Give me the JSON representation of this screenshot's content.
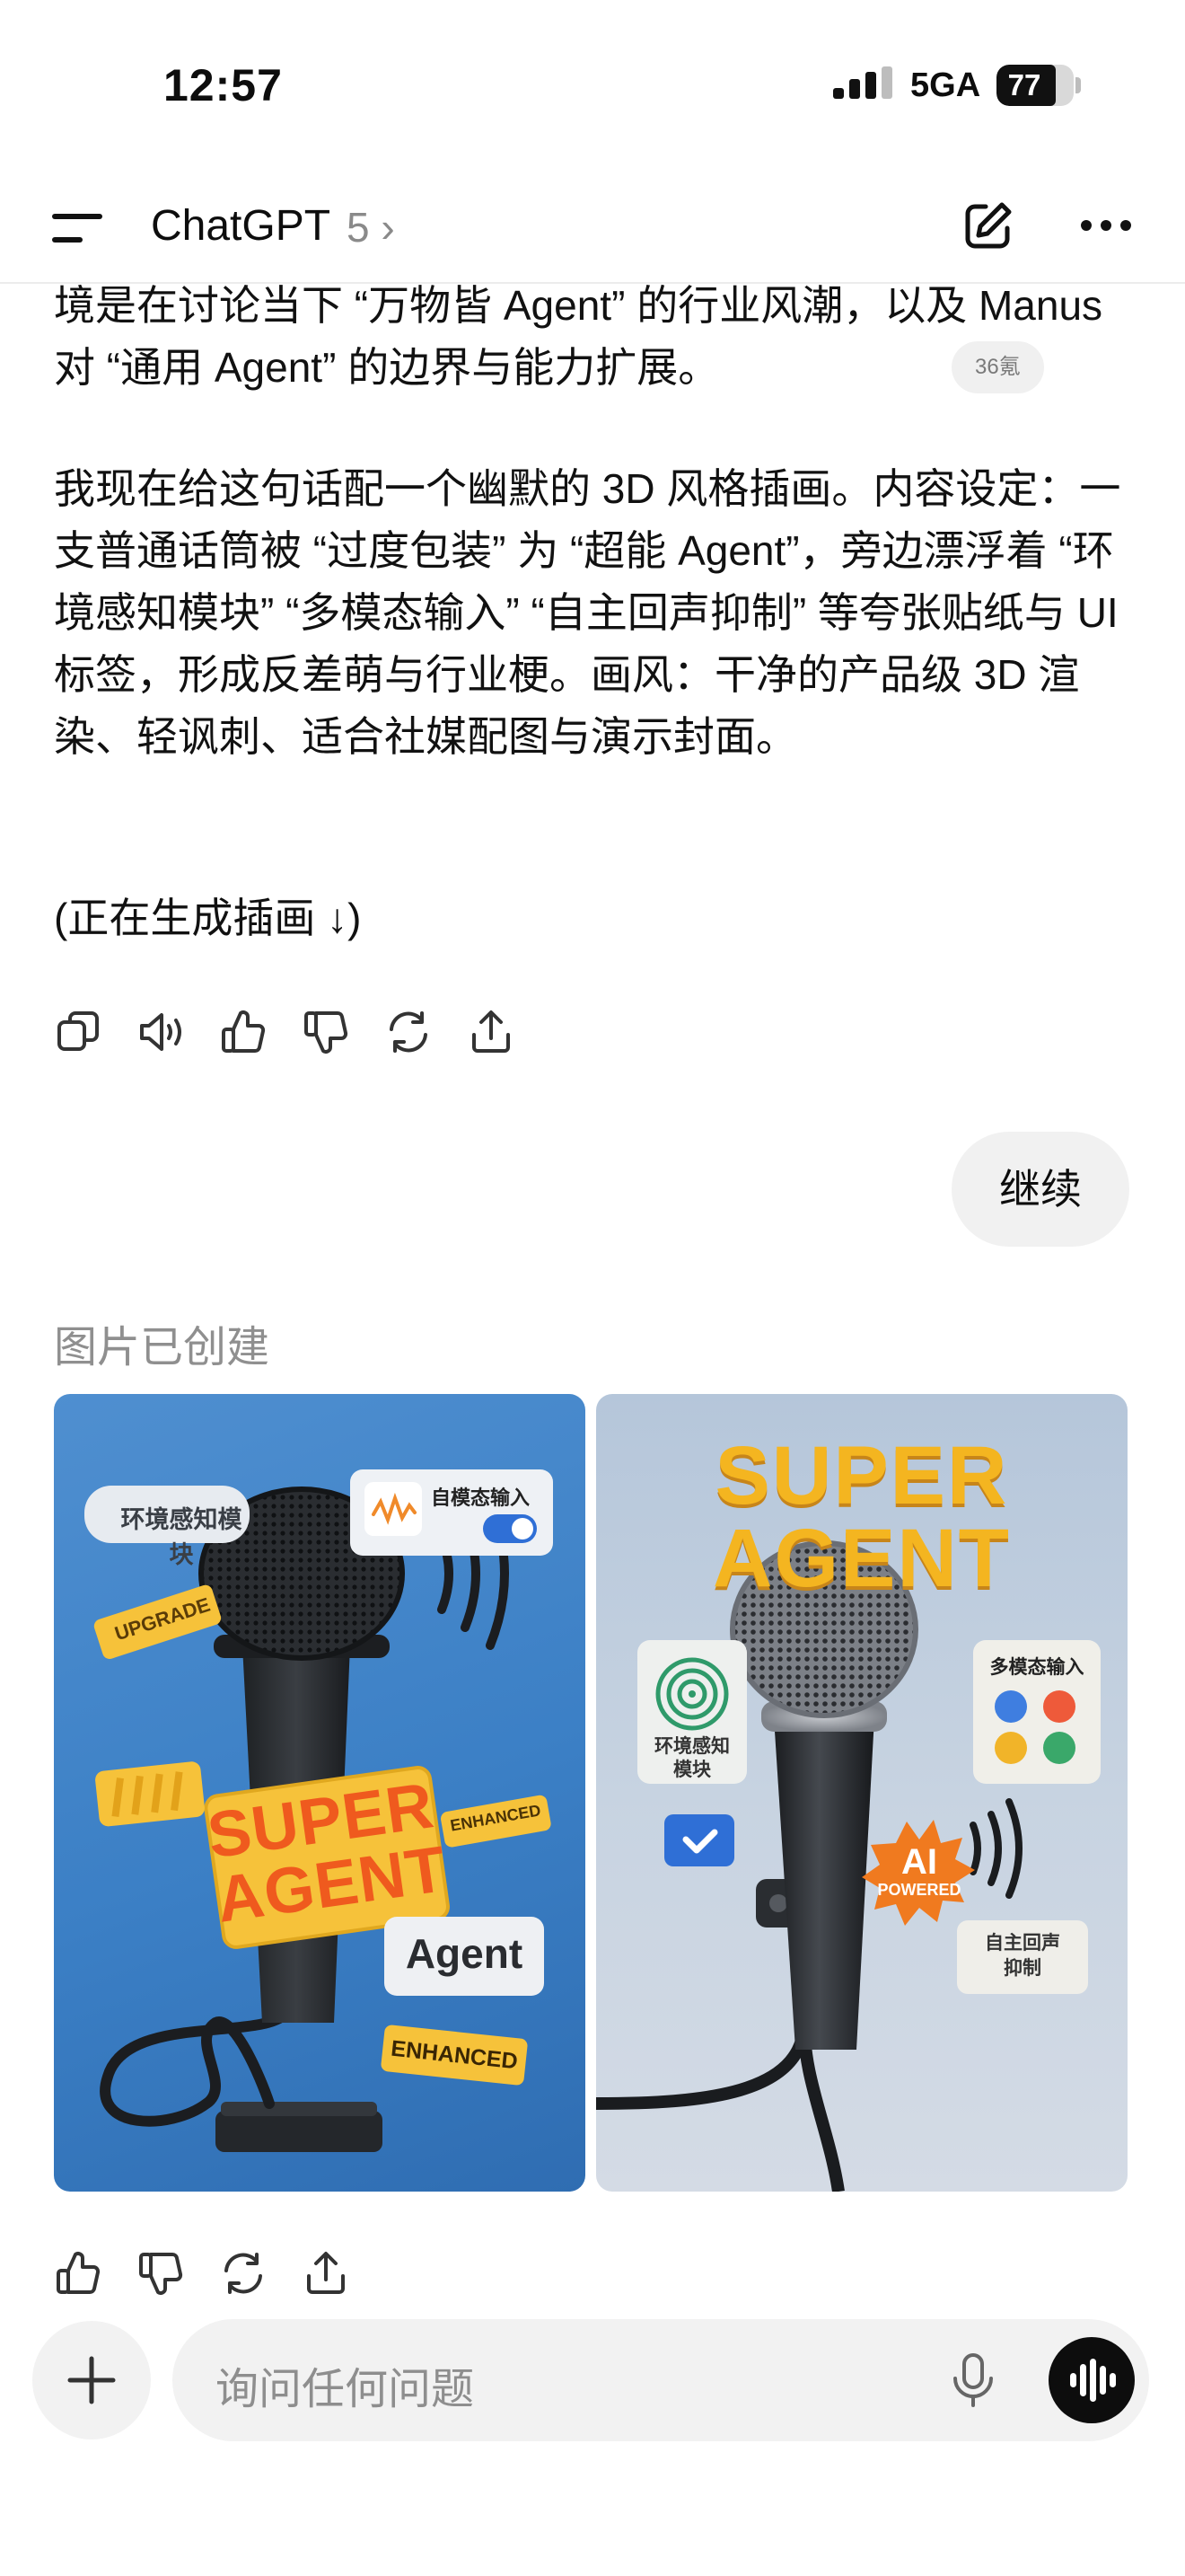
{
  "status_bar": {
    "time": "12:57",
    "network": "5GA",
    "battery": "77",
    "battery_level": 0.77
  },
  "header": {
    "title": "ChatGPT",
    "model": "5 ›"
  },
  "message": {
    "para1": "境是在讨论当下 “万物皆 Agent” 的行业风潮，以及 Manus 对 “通用 Agent” 的边界与能力扩展。",
    "citation": "36氪",
    "para2": "我现在给这句话配一个幽默的 3D 风格插画。内容设定：一支普通话筒被 “过度包装” 为 “超能 Agent”，旁边漂浮着 “环境感知模块” “多模态输入” “自主回声抑制” 等夸张贴纸与 UI 标签，形成反差萌与行业梗。画风：干净的产品级 3D 渲染、轻讽刺、适合社媒配图与演示封面。",
    "para3": "(正在生成插画 ↓)"
  },
  "user_message": "继续",
  "image_section_label": "图片已创建",
  "image1": {
    "label_env": "环境感知模块",
    "label_multimodal": "自模态输入",
    "label_upgrade": "UPGRADE",
    "super_line1": "SUPER",
    "super_line2": "AGENT",
    "label_enhanced_small": "ENHANCED",
    "label_agent": "Agent",
    "label_enhanced": "ENHANCED"
  },
  "image2": {
    "title_line1": "SUPER",
    "title_line2": "AGENT",
    "label_env_line1": "环境感知",
    "label_env_line2": "模块",
    "label_multimodal": "多模态输入",
    "badge_line1": "AI",
    "badge_line2": "POWERED",
    "label_echo_line1": "自主回声",
    "label_echo_line2": "抑制"
  },
  "composer": {
    "placeholder": "询问任何问题"
  },
  "colors": {
    "accent_yellow": "#f6c23a",
    "accent_orange": "#ef6a1f",
    "img1_bg": "#3b7fc5",
    "img2_bg": "#c3cfdd"
  }
}
